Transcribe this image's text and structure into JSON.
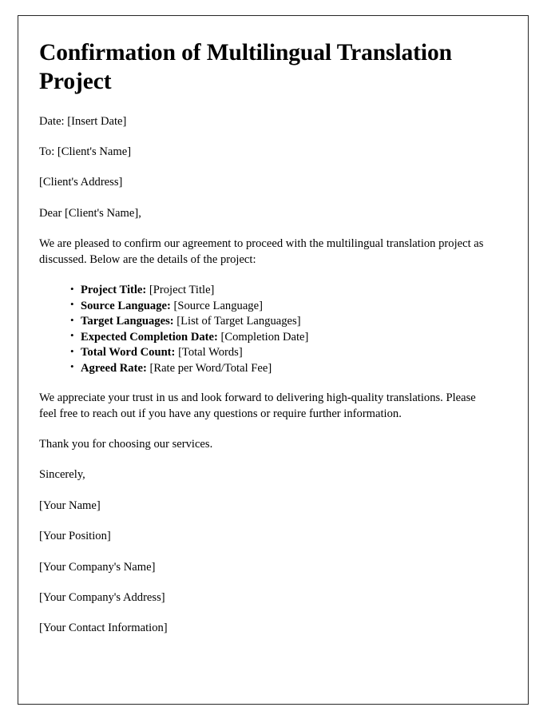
{
  "document": {
    "title": "Confirmation of Multilingual Translation Project",
    "date_line": "Date: [Insert Date]",
    "to_line": "To: [Client's Name]",
    "address_line": "[Client's Address]",
    "salutation": "Dear [Client's Name],",
    "intro_paragraph": "We are pleased to confirm our agreement to proceed with the multilingual translation project as discussed. Below are the details of the project:",
    "details": [
      {
        "label": "Project Title:",
        "value": "[Project Title]"
      },
      {
        "label": "Source Language:",
        "value": "[Source Language]"
      },
      {
        "label": "Target Languages:",
        "value": "[List of Target Languages]"
      },
      {
        "label": "Expected Completion Date:",
        "value": "[Completion Date]"
      },
      {
        "label": "Total Word Count:",
        "value": "[Total Words]"
      },
      {
        "label": "Agreed Rate:",
        "value": "[Rate per Word/Total Fee]"
      }
    ],
    "appreciation_paragraph": "We appreciate your trust in us and look forward to delivering high-quality translations. Please feel free to reach out if you have any questions or require further information.",
    "thanks_paragraph": "Thank you for choosing our services.",
    "closing": "Sincerely,",
    "signature": [
      "[Your Name]",
      "[Your Position]",
      "[Your Company's Name]",
      "[Your Company's Address]",
      "[Your Contact Information]"
    ]
  },
  "colors": {
    "page_border": "#262626",
    "text": "#000000",
    "background": "#ffffff"
  }
}
